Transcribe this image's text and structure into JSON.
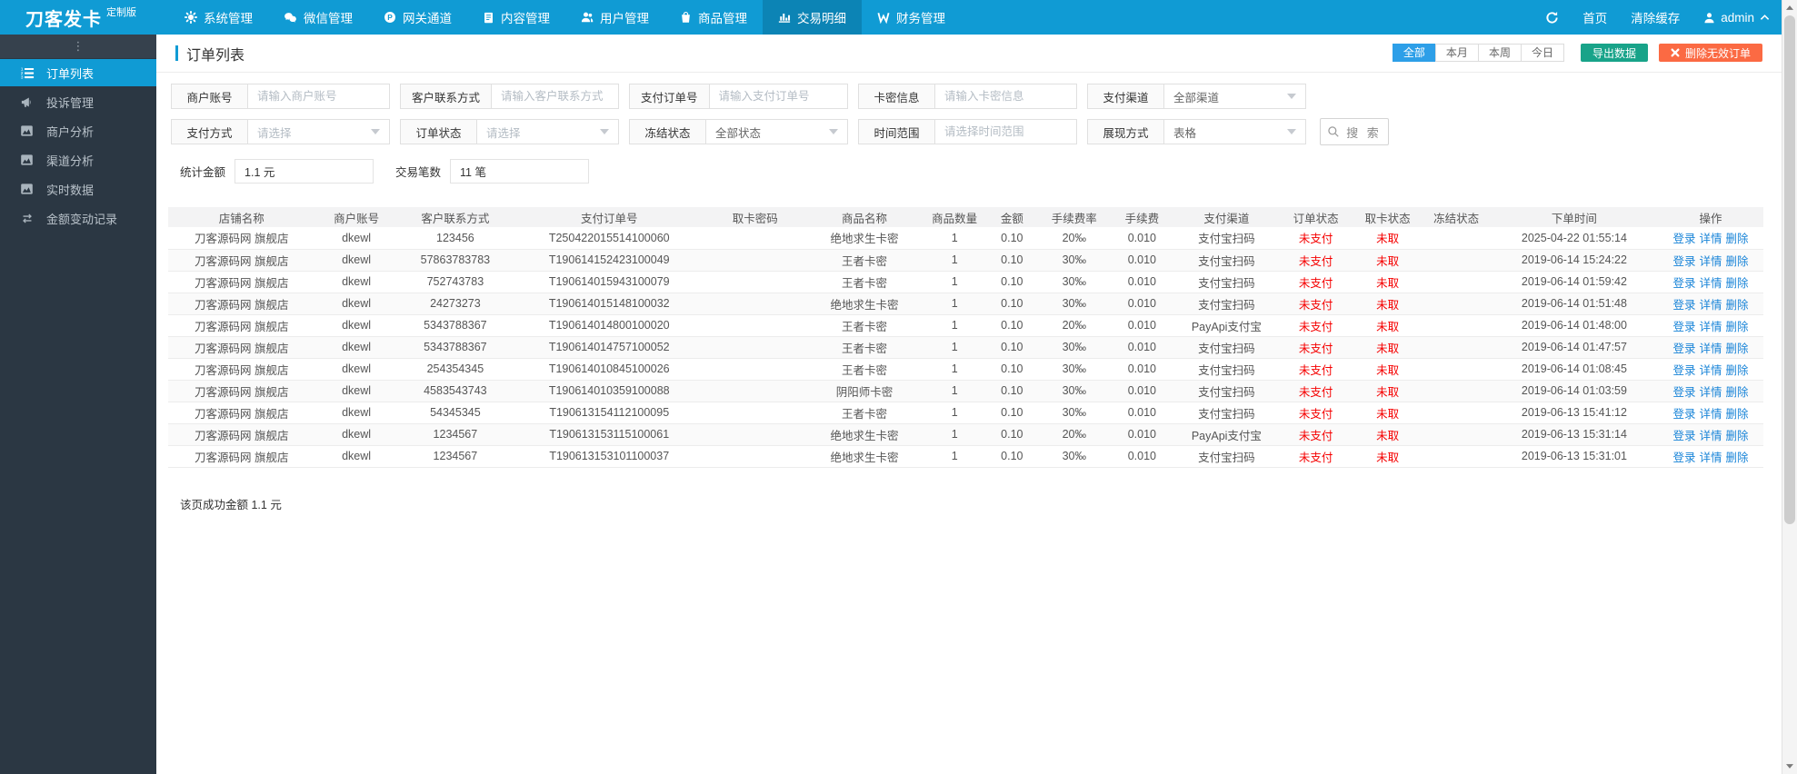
{
  "colors": {
    "navbar": "#109bd4",
    "navbar_active": "#0c84b5",
    "sidebar": "#2b3743",
    "accent_blue": "#2d9fe8",
    "export_green": "#18a389",
    "delete_orange": "#fb6a43",
    "link_blue": "#1a85d8",
    "status_red": "#f50000"
  },
  "brand": {
    "name": "刀客发卡",
    "badge": "定制版"
  },
  "topnav": {
    "items": [
      {
        "key": "system",
        "label": "系统管理",
        "icon": "gear-icon",
        "active": false
      },
      {
        "key": "wechat",
        "label": "微信管理",
        "icon": "wechat-icon",
        "active": false
      },
      {
        "key": "gateway",
        "label": "网关通道",
        "icon": "gateway-p-icon",
        "active": false
      },
      {
        "key": "content",
        "label": "内容管理",
        "icon": "document-icon",
        "active": false
      },
      {
        "key": "users",
        "label": "用户管理",
        "icon": "users-icon",
        "active": false
      },
      {
        "key": "goods",
        "label": "商品管理",
        "icon": "bag-icon",
        "active": false
      },
      {
        "key": "trades",
        "label": "交易明细",
        "icon": "chart-bar-icon",
        "active": true
      },
      {
        "key": "finance",
        "label": "财务管理",
        "icon": "finance-icon",
        "active": false
      }
    ],
    "right": {
      "home": "首页",
      "clear_cache": "清除缓存",
      "user": "admin"
    }
  },
  "sidebar": {
    "more": "⋮",
    "items": [
      {
        "key": "orders",
        "label": "订单列表",
        "icon": "ordered-list-icon",
        "active": true
      },
      {
        "key": "complaints",
        "label": "投诉管理",
        "icon": "megaphone-icon",
        "active": false
      },
      {
        "key": "merchant-analytics",
        "label": "商户分析",
        "icon": "area-chart-icon",
        "active": false
      },
      {
        "key": "channel-analytics",
        "label": "渠道分析",
        "icon": "area-chart-icon",
        "active": false
      },
      {
        "key": "realtime-data",
        "label": "实时数据",
        "icon": "area-chart-icon",
        "active": false
      },
      {
        "key": "balance-log",
        "label": "金额变动记录",
        "icon": "exchange-icon",
        "active": false
      }
    ]
  },
  "page": {
    "title": "订单列表",
    "range_tabs": [
      {
        "key": "all",
        "label": "全部",
        "active": true
      },
      {
        "key": "month",
        "label": "本月",
        "active": false
      },
      {
        "key": "week",
        "label": "本周",
        "active": false
      },
      {
        "key": "today",
        "label": "今日",
        "active": false
      }
    ],
    "export_label": "导出数据",
    "delete_label": "删除无效订单",
    "filters_row1": [
      {
        "key": "merchant-account",
        "label": "商户账号",
        "type": "input",
        "placeholder": "请输入商户账号"
      },
      {
        "key": "customer-contact",
        "label": "客户联系方式",
        "type": "input",
        "placeholder": "请输入客户联系方式"
      },
      {
        "key": "payment-order-no",
        "label": "支付订单号",
        "type": "input",
        "placeholder": "请输入支付订单号"
      },
      {
        "key": "card-info",
        "label": "卡密信息",
        "type": "input",
        "placeholder": "请输入卡密信息"
      },
      {
        "key": "pay-channel",
        "label": "支付渠道",
        "type": "select",
        "value": "全部渠道",
        "muted": false
      }
    ],
    "filters_row2": [
      {
        "key": "pay-method",
        "label": "支付方式",
        "type": "select",
        "value": "请选择",
        "muted": true
      },
      {
        "key": "order-status",
        "label": "订单状态",
        "type": "select",
        "value": "请选择",
        "muted": true
      },
      {
        "key": "freeze-status",
        "label": "冻结状态",
        "type": "select",
        "value": "全部状态",
        "muted": false
      },
      {
        "key": "time-range",
        "label": "时间范围",
        "type": "input",
        "placeholder": "请选择时间范围"
      },
      {
        "key": "display-mode",
        "label": "展现方式",
        "type": "select",
        "value": "表格",
        "muted": false
      }
    ],
    "search_label": "搜 索",
    "stats": [
      {
        "key": "total-amount",
        "label": "统计金额",
        "value": "1.1 元"
      },
      {
        "key": "trade-count",
        "label": "交易笔数",
        "value": "11 笔"
      }
    ],
    "table": {
      "headers": [
        "店铺名称",
        "商户账号",
        "客户联系方式",
        "支付订单号",
        "取卡密码",
        "商品名称",
        "商品数量",
        "金额",
        "手续费率",
        "手续费",
        "支付渠道",
        "订单状态",
        "取卡状态",
        "冻结状态",
        "下单时间",
        "操作"
      ],
      "actions": [
        "登录",
        "详情",
        "删除"
      ],
      "rows": [
        [
          "刀客源码网 旗舰店",
          "dkewl",
          "123456",
          "T250422015514100060",
          "",
          "绝地求生卡密",
          "1",
          "0.10",
          "20‰",
          "0.010",
          "支付宝扫码",
          "未支付",
          "未取",
          "",
          "2025-04-22 01:55:14"
        ],
        [
          "刀客源码网 旗舰店",
          "dkewl",
          "57863783783",
          "T190614152423100049",
          "",
          "王者卡密",
          "1",
          "0.10",
          "30‰",
          "0.010",
          "支付宝扫码",
          "未支付",
          "未取",
          "",
          "2019-06-14 15:24:22"
        ],
        [
          "刀客源码网 旗舰店",
          "dkewl",
          "752743783",
          "T190614015943100079",
          "",
          "王者卡密",
          "1",
          "0.10",
          "30‰",
          "0.010",
          "支付宝扫码",
          "未支付",
          "未取",
          "",
          "2019-06-14 01:59:42"
        ],
        [
          "刀客源码网 旗舰店",
          "dkewl",
          "24273273",
          "T190614015148100032",
          "",
          "绝地求生卡密",
          "1",
          "0.10",
          "30‰",
          "0.010",
          "支付宝扫码",
          "未支付",
          "未取",
          "",
          "2019-06-14 01:51:48"
        ],
        [
          "刀客源码网 旗舰店",
          "dkewl",
          "5343788367",
          "T190614014800100020",
          "",
          "王者卡密",
          "1",
          "0.10",
          "20‰",
          "0.010",
          "PayApi支付宝",
          "未支付",
          "未取",
          "",
          "2019-06-14 01:48:00"
        ],
        [
          "刀客源码网 旗舰店",
          "dkewl",
          "5343788367",
          "T190614014757100052",
          "",
          "王者卡密",
          "1",
          "0.10",
          "30‰",
          "0.010",
          "支付宝扫码",
          "未支付",
          "未取",
          "",
          "2019-06-14 01:47:57"
        ],
        [
          "刀客源码网 旗舰店",
          "dkewl",
          "254354345",
          "T190614010845100026",
          "",
          "王者卡密",
          "1",
          "0.10",
          "30‰",
          "0.010",
          "支付宝扫码",
          "未支付",
          "未取",
          "",
          "2019-06-14 01:08:45"
        ],
        [
          "刀客源码网 旗舰店",
          "dkewl",
          "4583543743",
          "T190614010359100088",
          "",
          "阴阳师卡密",
          "1",
          "0.10",
          "30‰",
          "0.010",
          "支付宝扫码",
          "未支付",
          "未取",
          "",
          "2019-06-14 01:03:59"
        ],
        [
          "刀客源码网 旗舰店",
          "dkewl",
          "54345345",
          "T190613154112100095",
          "",
          "王者卡密",
          "1",
          "0.10",
          "30‰",
          "0.010",
          "支付宝扫码",
          "未支付",
          "未取",
          "",
          "2019-06-13 15:41:12"
        ],
        [
          "刀客源码网 旗舰店",
          "dkewl",
          "1234567",
          "T190613153115100061",
          "",
          "绝地求生卡密",
          "1",
          "0.10",
          "20‰",
          "0.010",
          "PayApi支付宝",
          "未支付",
          "未取",
          "",
          "2019-06-13 15:31:14"
        ],
        [
          "刀客源码网 旗舰店",
          "dkewl",
          "1234567",
          "T190613153101100037",
          "",
          "绝地求生卡密",
          "1",
          "0.10",
          "30‰",
          "0.010",
          "支付宝扫码",
          "未支付",
          "未取",
          "",
          "2019-06-13 15:31:01"
        ]
      ]
    },
    "footer": "该页成功金额 1.1 元"
  }
}
